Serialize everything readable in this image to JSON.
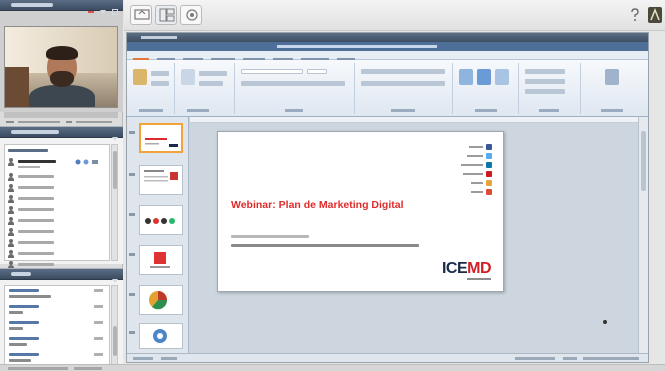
{
  "slide": {
    "title": "Webinar: Plan de Marketing Digital",
    "logo_main": "ICE",
    "logo_accent": "MD"
  },
  "colors": {
    "slide_title": "#e02b2b",
    "logo_dark": "#1a2a4a",
    "logo_red": "#d21f26",
    "pod_header": "#3d4e63",
    "ppt_titlebar": "#4e6f98",
    "selected_thumbnail": "#f2a43a"
  },
  "icons": {
    "webcam": "webcam-feed",
    "attendee": "person-icon",
    "social": [
      "facebook-icon",
      "twitter-icon",
      "linkedin-icon",
      "youtube-icon",
      "slideshare-icon",
      "googleplus-icon"
    ]
  }
}
